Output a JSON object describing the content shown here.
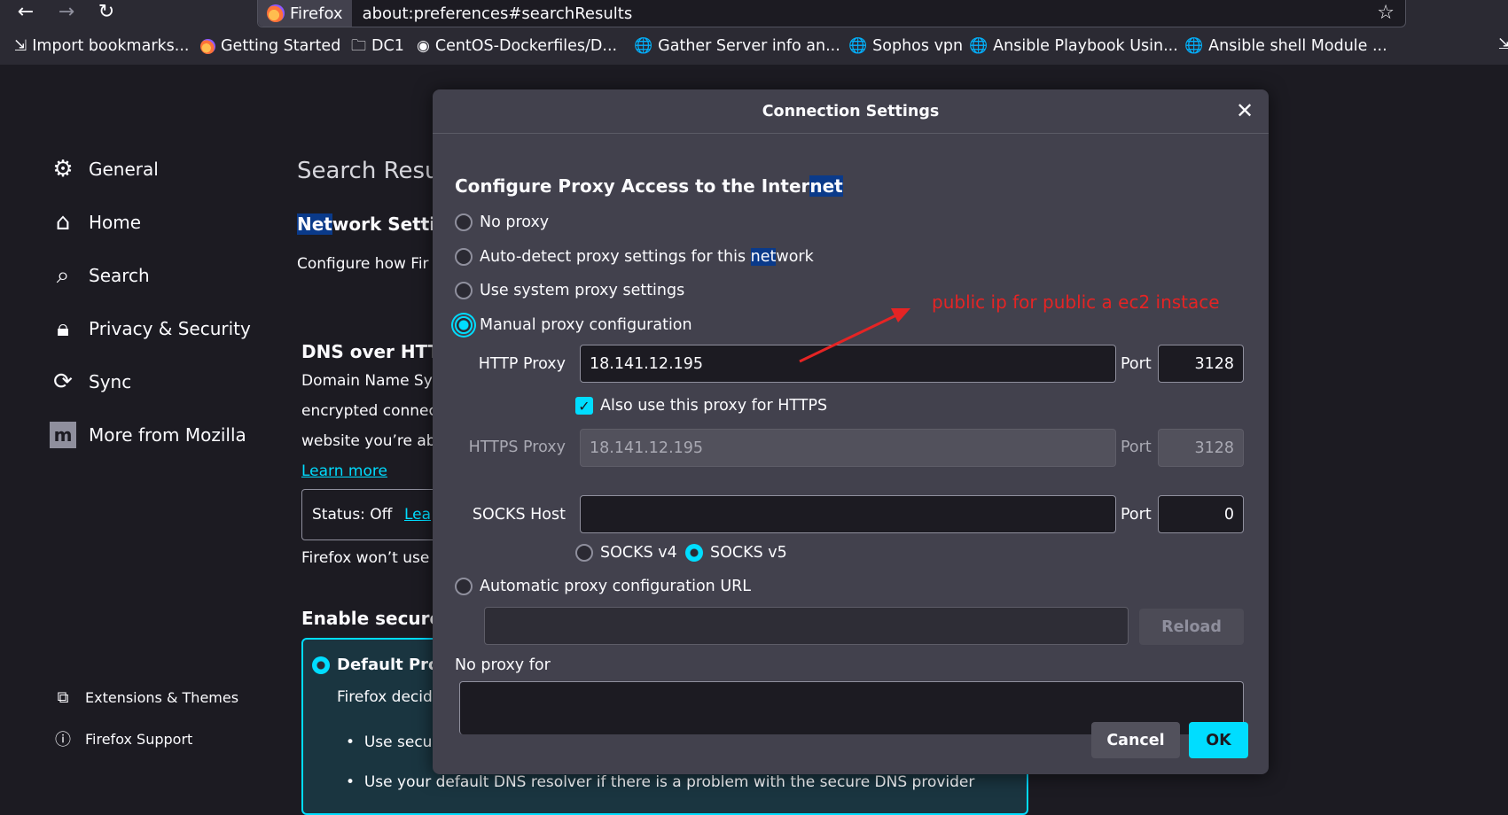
{
  "browser": {
    "tab_title": "Firefox",
    "url": "about:preferences#searchResults",
    "bookmarks": [
      "Import bookmarks...",
      "Getting Started",
      "DC1",
      "CentOS-Dockerfiles/D...",
      "Gather Server info an...",
      "Sophos vpn",
      "Ansible Playbook Usin...",
      "Ansible shell Module ..."
    ]
  },
  "sidebar": {
    "items": [
      {
        "label": "General",
        "icon": "gear-icon"
      },
      {
        "label": "Home",
        "icon": "home-icon"
      },
      {
        "label": "Search",
        "icon": "search-icon"
      },
      {
        "label": "Privacy & Security",
        "icon": "lock-icon"
      },
      {
        "label": "Sync",
        "icon": "sync-icon"
      },
      {
        "label": "More from Mozilla",
        "icon": "mozilla-icon"
      }
    ],
    "footer": [
      {
        "label": "Extensions & Themes",
        "icon": "puzzle-icon"
      },
      {
        "label": "Firefox Support",
        "icon": "help-icon"
      }
    ]
  },
  "page": {
    "title": "Search Resul",
    "network_heading_hl": "Net",
    "network_heading_rest": "work Settin",
    "network_desc": "Configure how Fir",
    "dns_heading": "DNS over HTT",
    "dns_line1": "Domain Name Sys",
    "dns_line2": "encrypted connec",
    "dns_line3": "website you’re ab",
    "learn_more": "Learn more",
    "status_text": "Status: Off",
    "status_link": "Lea",
    "firefox_wont": "Firefox won’t use",
    "enable_heading": "Enable secure",
    "default_prot": "Default Prot",
    "firefox_decid": "Firefox decid",
    "bullet1": "Use secur",
    "bullet2": "Use your default DNS resolver if there is a problem with the secure DNS provider"
  },
  "dialog": {
    "title": "Connection Settings",
    "heading_pre": "Configure Proxy Access to the Inter",
    "heading_hl": "net",
    "options": {
      "no_proxy": "No proxy",
      "auto_detect_pre": "Auto-detect proxy settings for this ",
      "auto_detect_hl": "net",
      "auto_detect_post": "work",
      "system": "Use system proxy settings",
      "manual": "Manual proxy configuration",
      "auto_url": "Automatic proxy configuration URL"
    },
    "selected_option": "manual",
    "http_proxy_label": "HTTP Proxy",
    "http_proxy_value": "18.141.12.195",
    "http_port_label": "Port",
    "http_port_value": "3128",
    "also_https_label": "Also use this proxy for HTTPS",
    "also_https_checked": true,
    "https_proxy_label": "HTTPS Proxy",
    "https_proxy_value": "18.141.12.195",
    "https_port_label": "Port",
    "https_port_value": "3128",
    "socks_host_label": "SOCKS Host",
    "socks_host_value": "",
    "socks_port_label": "Port",
    "socks_port_value": "0",
    "socks_v4": "SOCKS v4",
    "socks_v5": "SOCKS v5",
    "socks_selected": "v5",
    "auto_url_value": "",
    "reload_label": "Reload",
    "no_proxy_for_label": "No proxy for",
    "no_proxy_for_value": "",
    "cancel_label": "Cancel",
    "ok_label": "OK"
  },
  "annotation": {
    "text": "public ip for public a ec2 instace",
    "color": "#e52424"
  },
  "colors": {
    "accent": "#00ddff",
    "dialog_bg": "#42414d",
    "page_bg": "#1c1b22"
  }
}
